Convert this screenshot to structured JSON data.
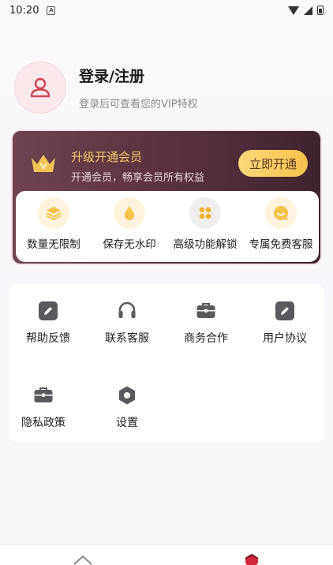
{
  "status_bar": {
    "time": "10:20",
    "notif_glyph": "A"
  },
  "profile": {
    "title": "登录/注册",
    "subtitle": "登录后可查看您的VIP特权",
    "avatar_icon": "user-icon"
  },
  "vip": {
    "title": "升级开通会员",
    "subtitle": "开通会员，畅享会员所有权益",
    "button": "立即开通",
    "accent": "#f5c96a",
    "perks": [
      {
        "label": "数量无限制",
        "icon": "layers-icon"
      },
      {
        "label": "保存无水印",
        "icon": "drop-icon"
      },
      {
        "label": "高级功能解锁",
        "icon": "grid-icon"
      },
      {
        "label": "专属免费客服",
        "icon": "smile-chat-icon"
      }
    ]
  },
  "services": [
    {
      "label": "帮助反馈",
      "icon": "edit-icon"
    },
    {
      "label": "联系客服",
      "icon": "headset-icon"
    },
    {
      "label": "商务合作",
      "icon": "briefcase-icon"
    },
    {
      "label": "用户协议",
      "icon": "edit-icon"
    },
    {
      "label": "隐私政策",
      "icon": "briefcase-icon"
    },
    {
      "label": "设置",
      "icon": "settings-icon"
    }
  ],
  "bottom_nav": [
    {
      "name": "home",
      "icon": "home-icon"
    },
    {
      "name": "mine",
      "icon": "profile-icon"
    }
  ]
}
